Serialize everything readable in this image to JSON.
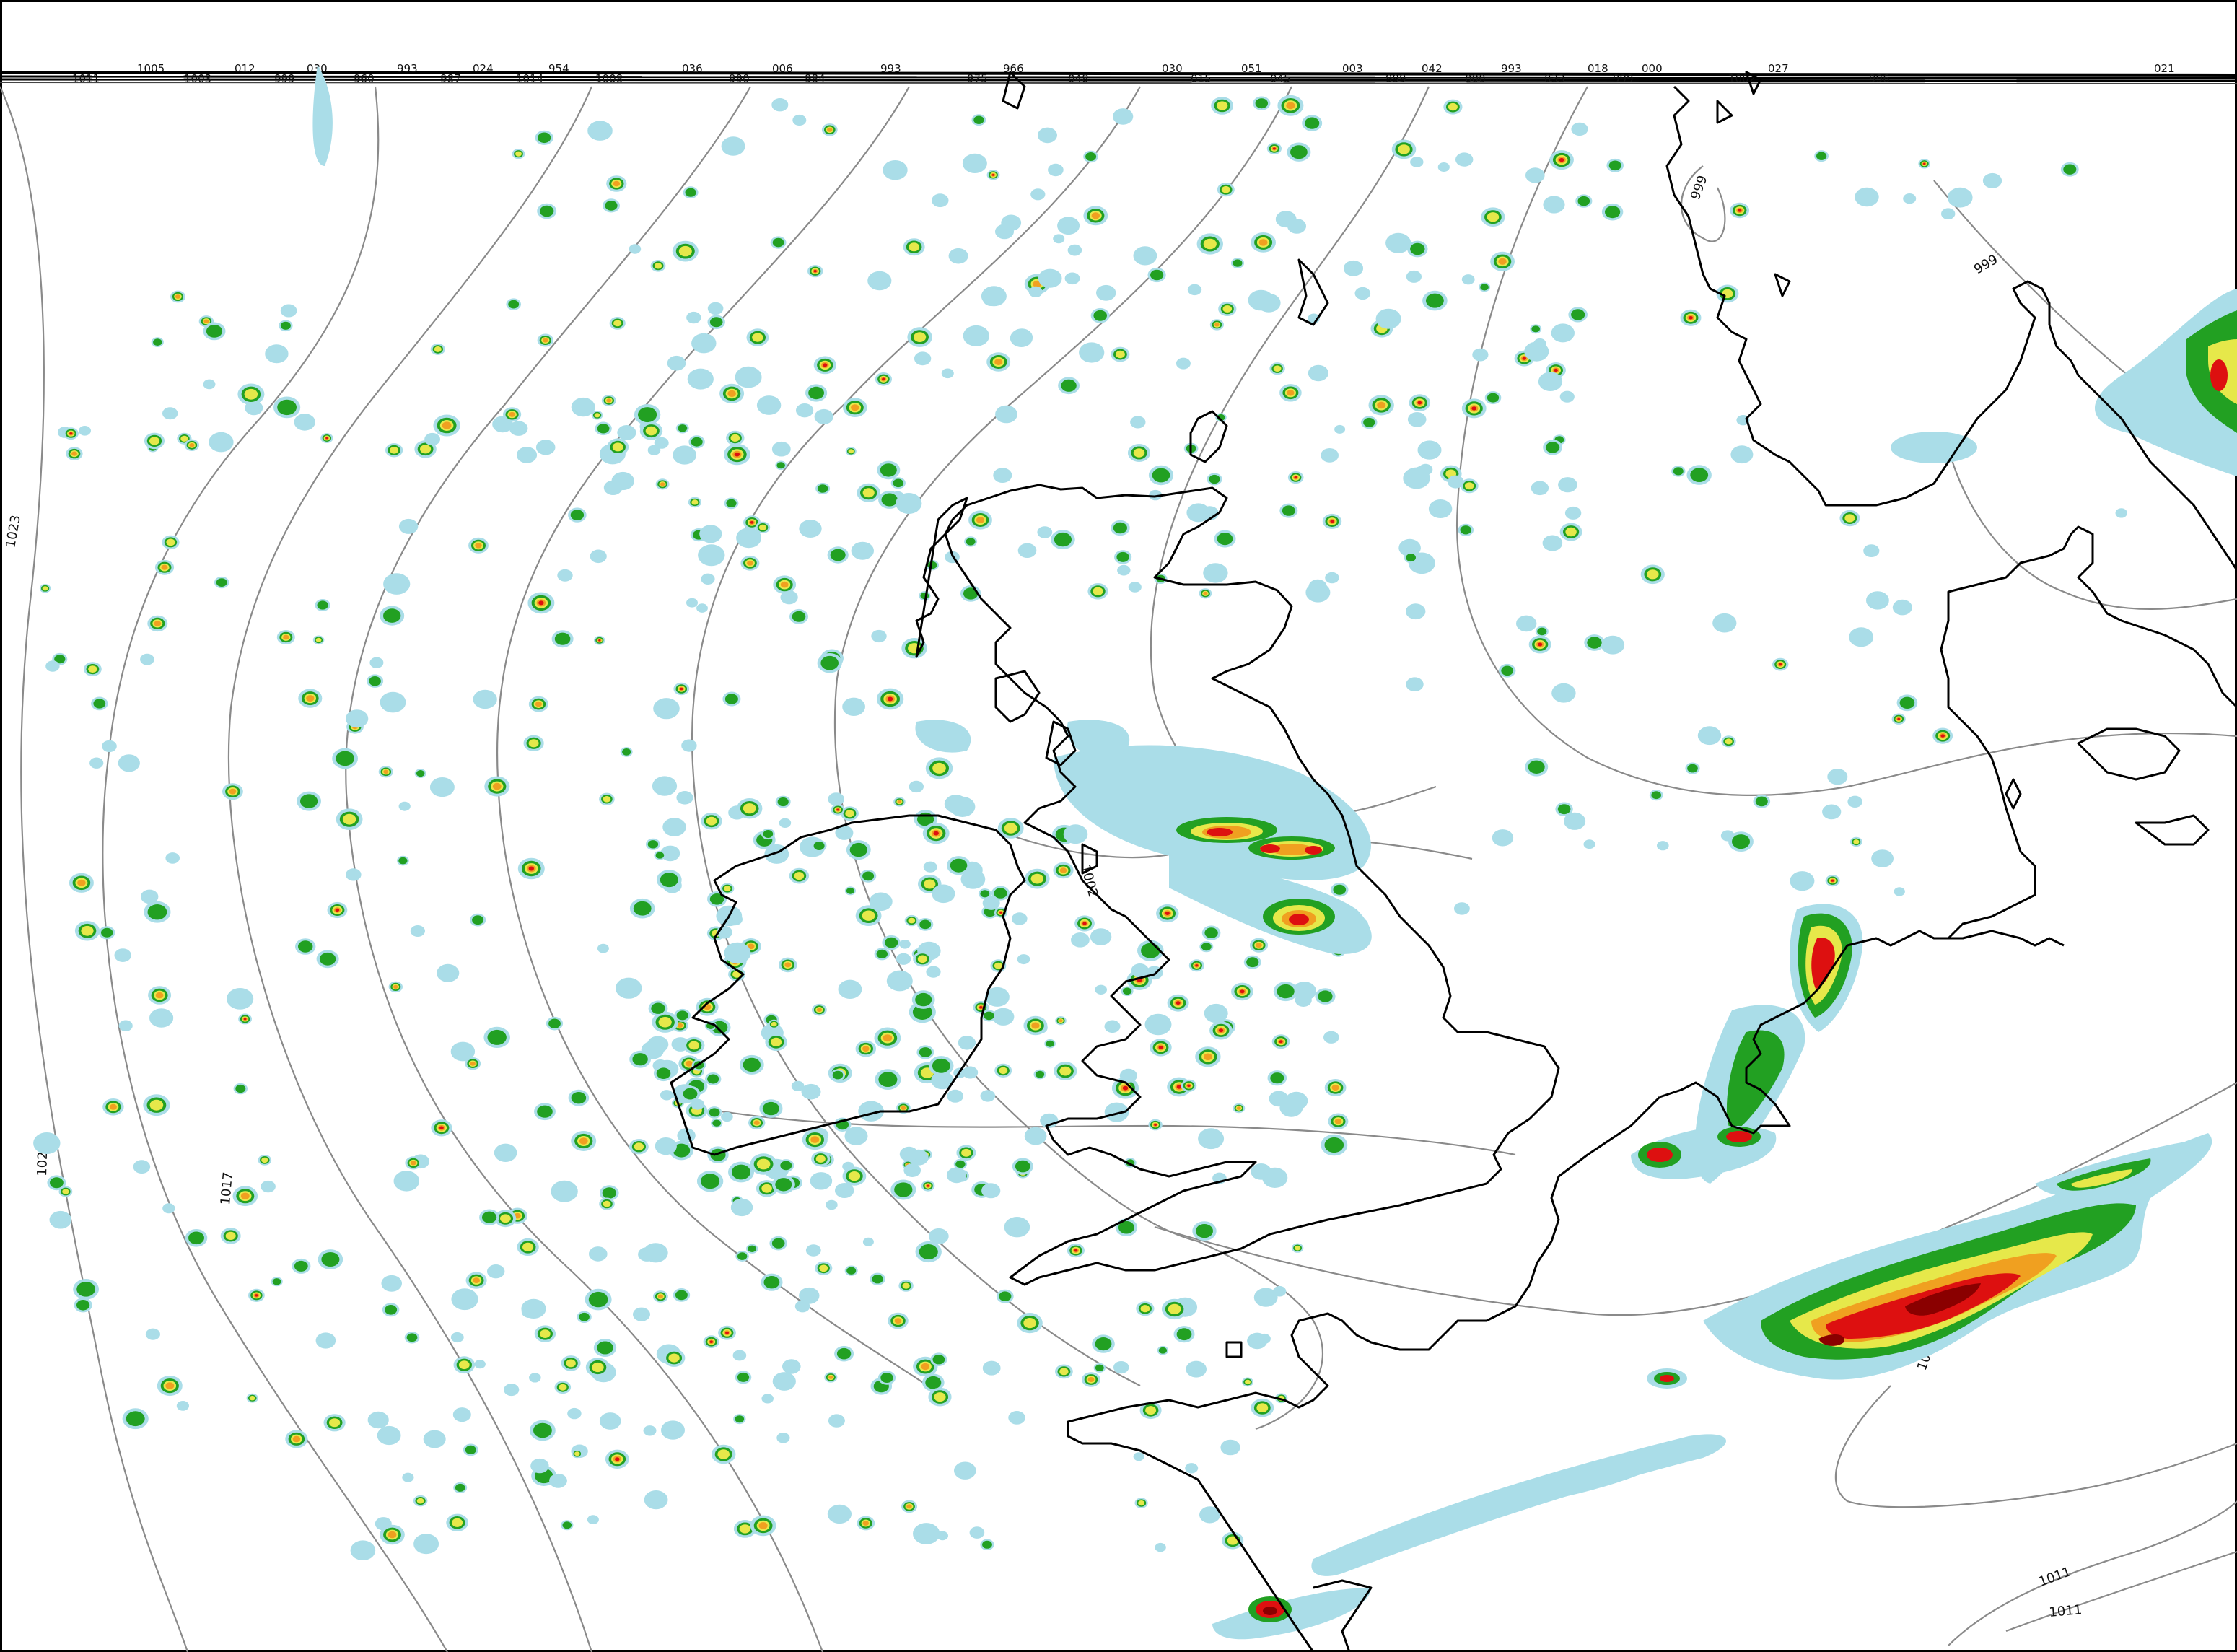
{
  "map": {
    "colors": {
      "light": "#aadde8",
      "green": "#22a022",
      "yellow": "#e6e84a",
      "orange": "#f0a020",
      "red": "#dd1010",
      "darkred": "#8a0000",
      "coast": "#000000",
      "isobar": "#8a8a8a"
    },
    "isobar_labels": [
      "1023",
      "1020",
      "1017",
      "1002",
      "999",
      "999",
      "1008",
      "1011",
      "1011"
    ],
    "top_labels": [
      "1011",
      "1005",
      "1003",
      "012",
      "999",
      "030",
      "960",
      "993",
      "987",
      "024",
      "1014",
      "954",
      "1008",
      "036",
      "990",
      "006",
      "984",
      "993",
      "975",
      "966",
      "048",
      "030",
      "015",
      "051",
      "045",
      "003",
      "999",
      "042",
      "000",
      "993",
      "033",
      "018",
      "999",
      "000",
      "1002",
      "027",
      "996",
      "021"
    ]
  }
}
